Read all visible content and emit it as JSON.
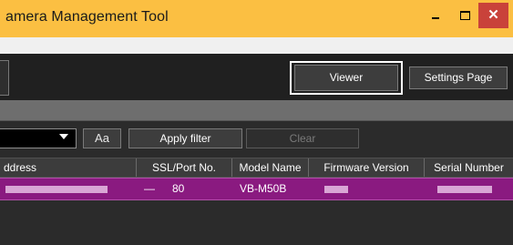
{
  "window": {
    "title": "amera Management Tool",
    "close_glyph": "✕",
    "controls": [
      "minimize-icon",
      "maximize-icon",
      "close-icon"
    ]
  },
  "toolbar": {
    "viewer_label": "Viewer",
    "settings_label": "Settings Page"
  },
  "filter": {
    "font_label": "Aa",
    "apply_label": "Apply filter",
    "clear_label": "Clear"
  },
  "table": {
    "columns": [
      "ddress",
      "SSL/Port No.",
      "Model Name",
      "Firmware Version",
      "Serial Number"
    ],
    "rows": [
      {
        "ssl": "—",
        "port": "80",
        "model": "VB-M50B"
      }
    ]
  },
  "colors": {
    "titlebar": "#fbbf42",
    "close_button": "#c9423a",
    "selected_row": "#8a1a80",
    "app_background": "#2b2b2b"
  }
}
